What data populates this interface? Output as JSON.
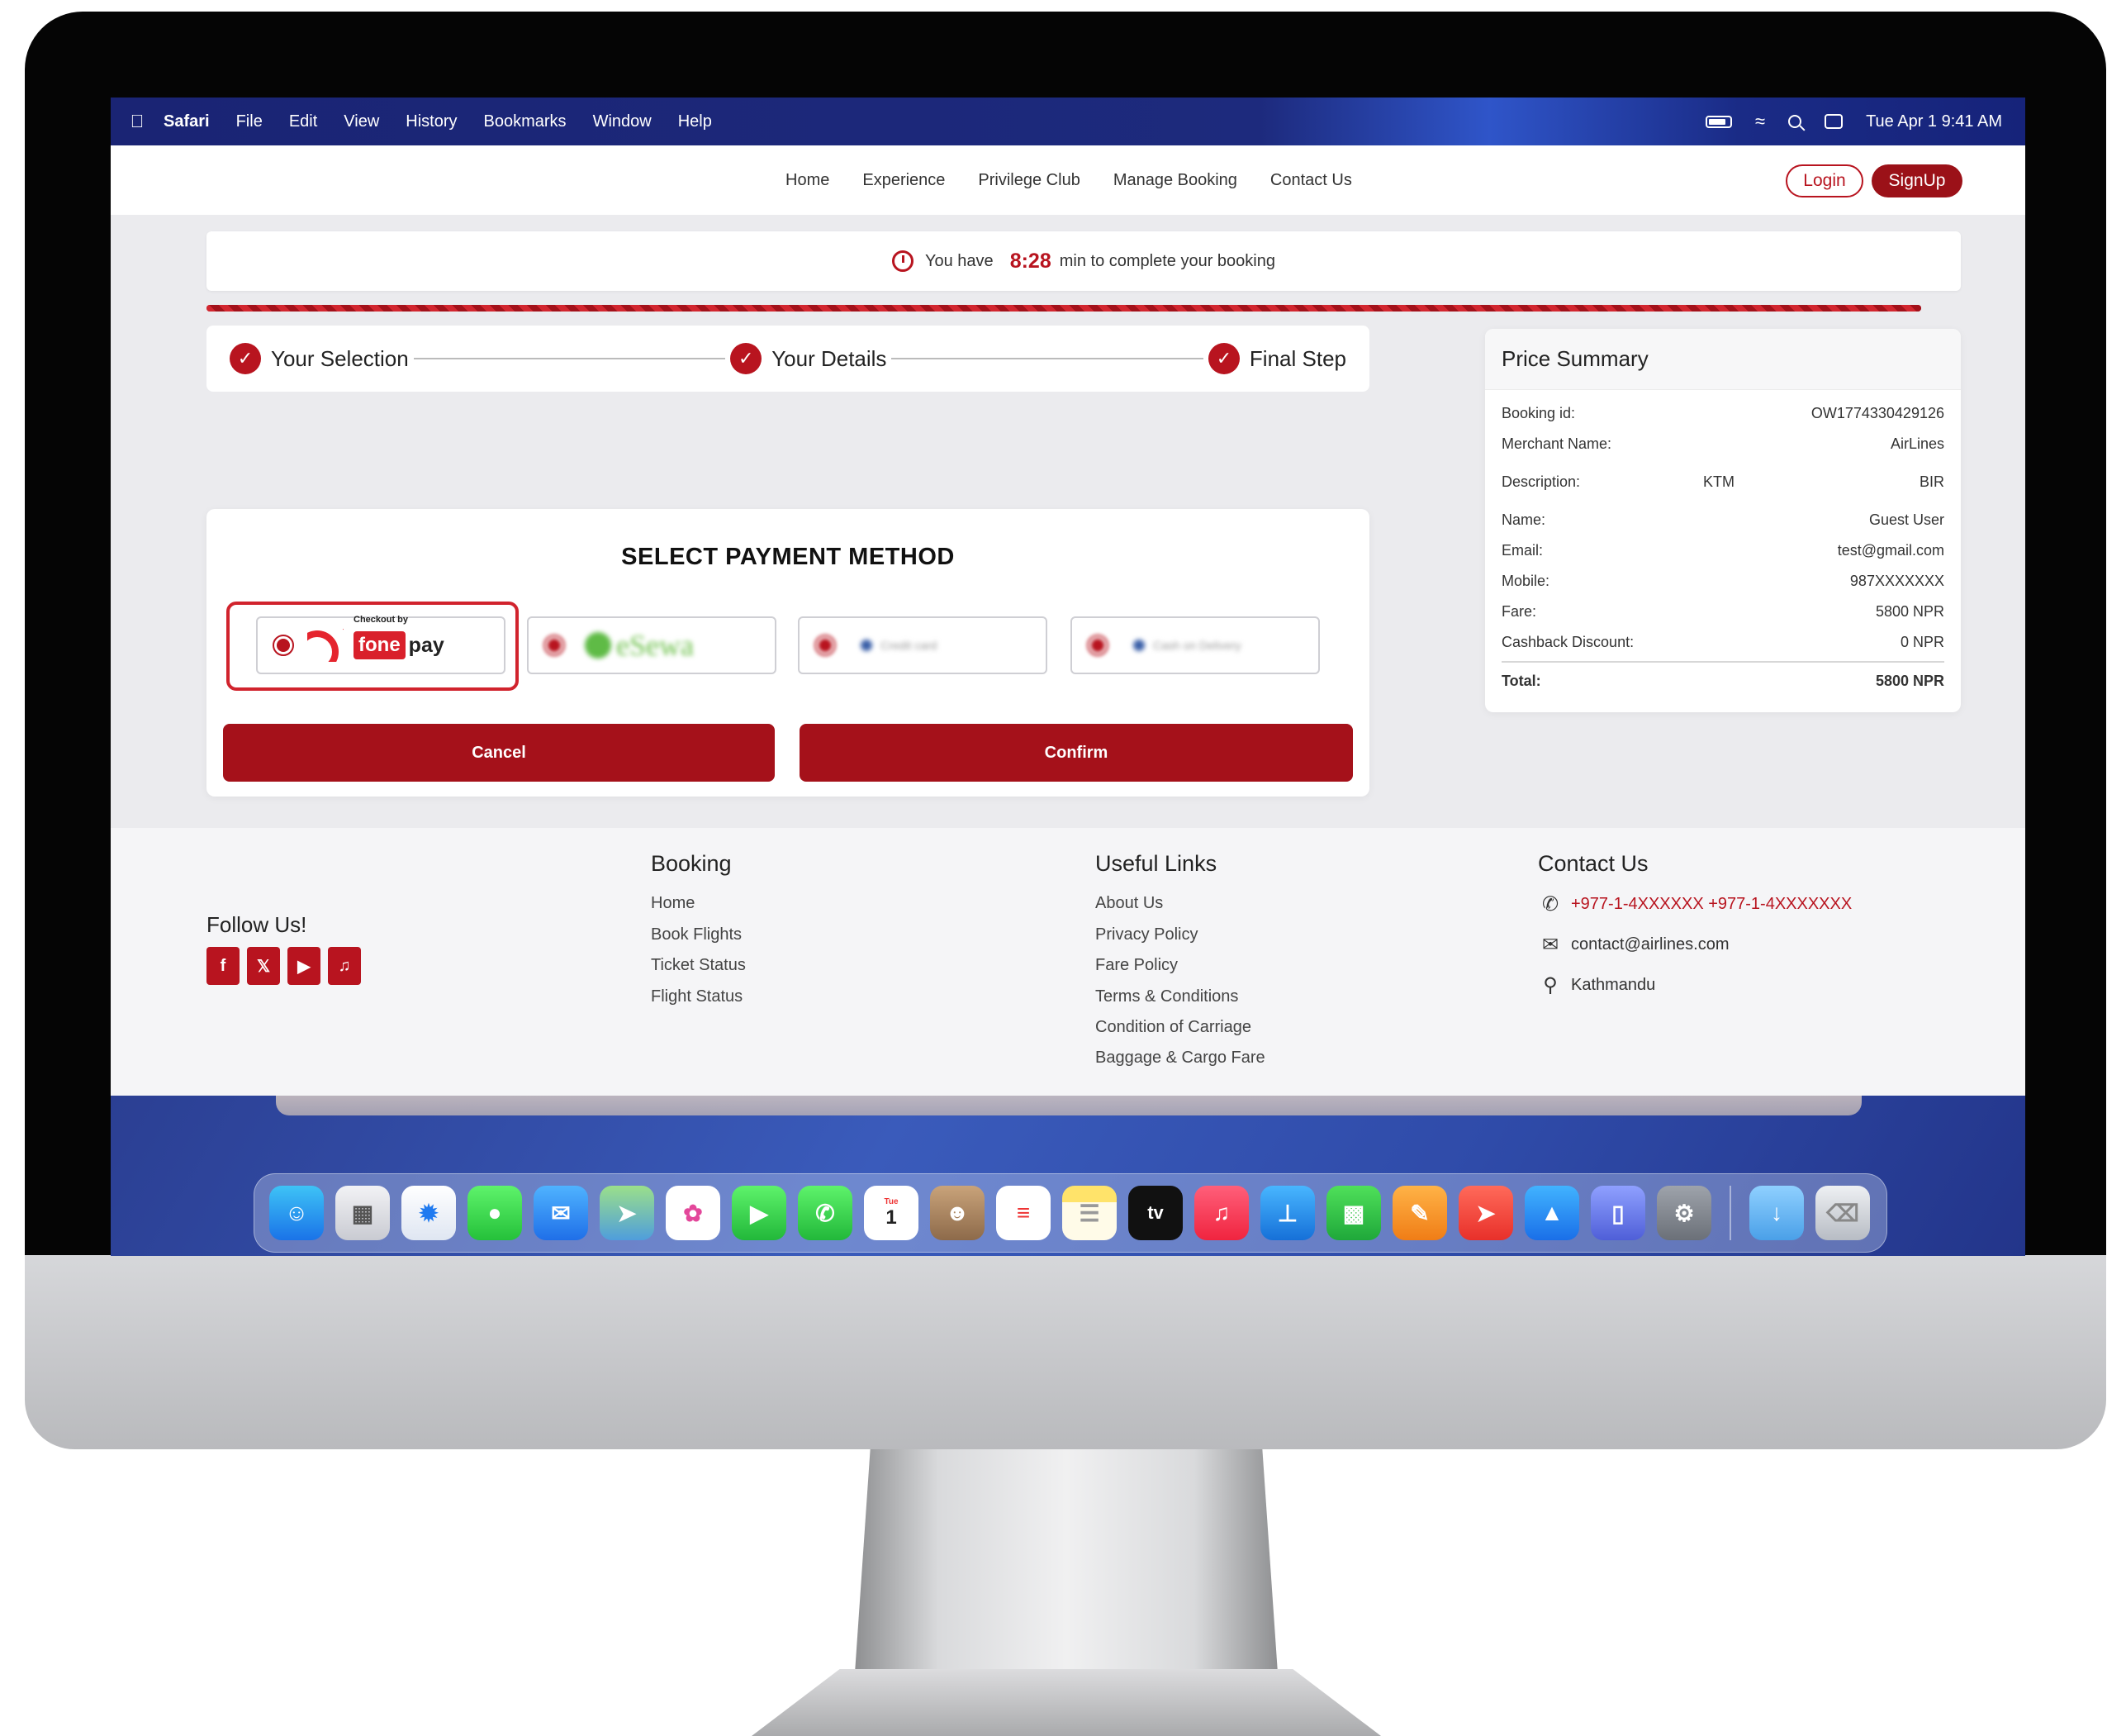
{
  "menubar": {
    "app_name": "Safari",
    "menus": [
      "File",
      "Edit",
      "View",
      "History",
      "Bookmarks",
      "Window",
      "Help"
    ],
    "datetime": "Tue Apr 1  9:41 AM"
  },
  "nav": {
    "links": [
      "Home",
      "Experience",
      "Privilege Club",
      "Manage Booking",
      "Contact Us"
    ],
    "login_label": "Login",
    "signup_label": "SignUp"
  },
  "timer": {
    "prefix": "You have",
    "value": "8:28",
    "suffix": "min to complete your booking",
    "progress_fraction": 1.0
  },
  "steps": [
    "Your Selection",
    "Your Details",
    "Final Step"
  ],
  "payment": {
    "title": "SELECT PAYMENT METHOD",
    "fonepay_checkout": "Checkout by",
    "fonepay_fone": "fone",
    "fonepay_pay": "pay",
    "esewa": "eSewa",
    "method3": "Credit card",
    "method4": "Cash on Delivery",
    "cancel_label": "Cancel",
    "confirm_label": "Confirm"
  },
  "summary": {
    "title": "Price Summary",
    "booking_id_label": "Booking id:",
    "booking_id": "OW1774330429126",
    "merchant_label": "Merchant Name:",
    "merchant": "AirLines",
    "description_label": "Description:",
    "description_from": "KTM",
    "description_to": "BIR",
    "name_label": "Name:",
    "name": "Guest User",
    "email_label": "Email:",
    "email": "test@gmail.com",
    "mobile_label": "Mobile:",
    "mobile": "987XXXXXXX",
    "fare_label": "Fare:",
    "fare": "5800  NPR",
    "cashback_label": "Cashback Discount:",
    "cashback": "0 NPR",
    "total_label": "Total:",
    "total": "5800 NPR"
  },
  "footer": {
    "follow_title": "Follow Us!",
    "social": [
      "facebook",
      "x",
      "youtube",
      "tiktok"
    ],
    "booking_title": "Booking",
    "booking_links": [
      "Home",
      "Book Flights",
      "Ticket Status",
      "Flight Status"
    ],
    "useful_title": "Useful Links",
    "useful_links": [
      "About Us",
      "Privacy Policy",
      "Fare Policy",
      "Terms & Conditions",
      "Condition of Carriage",
      "Baggage & Cargo Fare"
    ],
    "contact_title": "Contact Us",
    "phone": "+977-1-4XXXXXX  +977-1-4XXXXXXX",
    "email": "contact@airlines.com",
    "location": "Kathmandu"
  },
  "dock": {
    "apps": [
      "finder",
      "launchpad",
      "safari",
      "messages",
      "mail",
      "maps",
      "photos",
      "facetime",
      "phone",
      "calendar",
      "contacts",
      "reminders",
      "notes",
      "tv",
      "music",
      "keynote",
      "numbers",
      "pages",
      "rocket",
      "app-store",
      "iphone-mirroring",
      "system-settings"
    ],
    "calendar_day": "1",
    "calendar_month": "Tue",
    "tv_label": "tv"
  }
}
